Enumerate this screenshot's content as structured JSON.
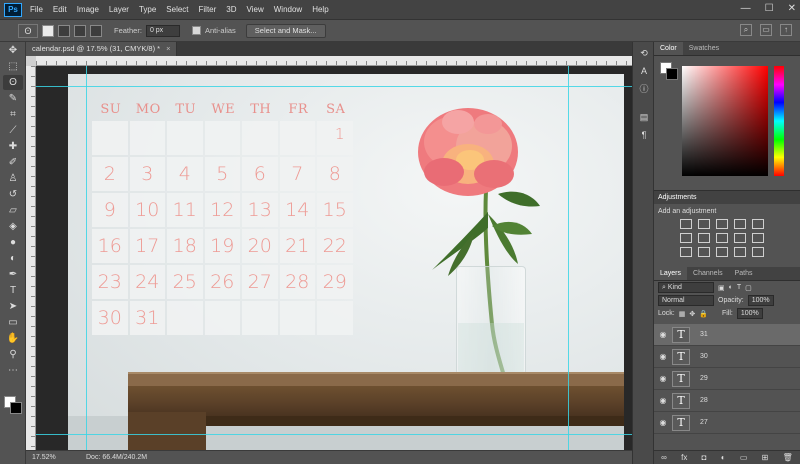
{
  "app": {
    "logo": "Ps"
  },
  "menu": [
    "File",
    "Edit",
    "Image",
    "Layer",
    "Type",
    "Select",
    "Filter",
    "3D",
    "View",
    "Window",
    "Help"
  ],
  "window_controls": {
    "minimize": "—",
    "maximize": "☐",
    "close": "✕"
  },
  "options_bar": {
    "feather_label": "Feather:",
    "feather_value": "0 px",
    "antialias_label": "Anti-alias",
    "select_mask_label": "Select and Mask..."
  },
  "document": {
    "tab_title": "calendar.psd @ 17.5% (31, CMYK/8) *",
    "close": "×"
  },
  "calendar": {
    "days": [
      "SU",
      "MO",
      "TU",
      "WE",
      "TH",
      "FR",
      "SA"
    ],
    "cells": [
      "",
      "",
      "",
      "",
      "",
      "",
      "1",
      "2",
      "3",
      "4",
      "5",
      "6",
      "7",
      "8",
      "9",
      "10",
      "11",
      "12",
      "13",
      "14",
      "15",
      "16",
      "17",
      "18",
      "19",
      "20",
      "21",
      "22",
      "23",
      "24",
      "25",
      "26",
      "27",
      "28",
      "29",
      "30",
      "31",
      "",
      "",
      "",
      "",
      ""
    ]
  },
  "statusbar": {
    "zoom": "17.52%",
    "doc": "Doc: 66.4M/240.2M"
  },
  "panels": {
    "color_tabs": [
      "Color",
      "Swatches"
    ],
    "adjustments_title": "Adjustments",
    "add_adjustment": "Add an adjustment",
    "layer_tabs": [
      "Layers",
      "Channels",
      "Paths"
    ],
    "kind_label": "Kind",
    "blend_mode": "Normal",
    "opacity_label": "Opacity:",
    "opacity_value": "100%",
    "lock_label": "Lock:",
    "fill_label": "Fill:",
    "fill_value": "100%",
    "layers": [
      {
        "name": "31",
        "selected": true
      },
      {
        "name": "30",
        "selected": false
      },
      {
        "name": "29",
        "selected": false
      },
      {
        "name": "28",
        "selected": false
      },
      {
        "name": "27",
        "selected": false
      }
    ]
  },
  "colors": {
    "accent": "#31a8ff",
    "calendar_text": "#ee9a94",
    "guide": "#39d5e5"
  }
}
